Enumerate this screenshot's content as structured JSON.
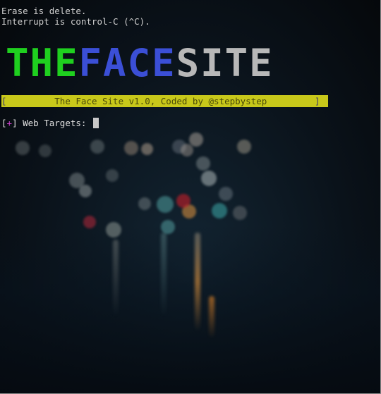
{
  "terminal": {
    "line1": "Erase is delete.",
    "line2": "Interrupt is control-C (^C)."
  },
  "logo": {
    "part1": "THE",
    "part2": "FACE",
    "part3": "SITE",
    "color1": "#1fd01f",
    "color2": "#3b4fd6",
    "color3": "#b8b8b8"
  },
  "banner": {
    "open_bracket": "[",
    "text": "         The Face Site v1.0, Coded by @stepbystep         ",
    "close_bracket": "]",
    "color": "#c8c81a"
  },
  "prompt": {
    "open_bracket": "[",
    "symbol": "+",
    "close_bracket": "]",
    "label": " Web Targets: "
  }
}
